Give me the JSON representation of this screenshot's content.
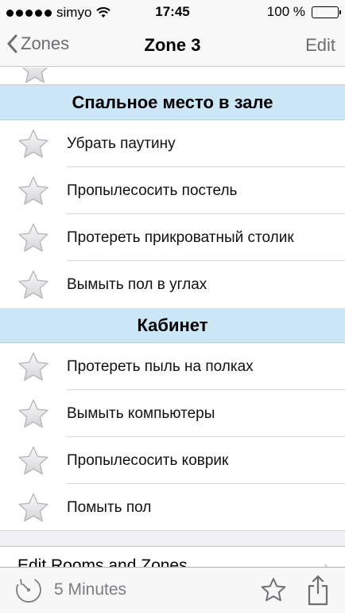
{
  "status_bar": {
    "carrier": "simyo",
    "time": "17:45",
    "battery": "100 %"
  },
  "nav": {
    "back_label": "Zones",
    "title": "Zone 3",
    "edit_label": "Edit"
  },
  "sections": [
    {
      "title": "Спальное место в зале",
      "tasks": [
        "Убрать паутину",
        "Пропылесосить постель",
        "Протереть прикроватный столик",
        "Вымыть пол в углах"
      ]
    },
    {
      "title": "Кабинет",
      "tasks": [
        "Протереть пыль на полках",
        "Вымыть компьютеры",
        "Пропылесосить коврик",
        "Помыть пол"
      ]
    }
  ],
  "footer": {
    "edit_rooms_label": "Edit Rooms and Zones"
  },
  "toolbar": {
    "timer_label": "5 Minutes",
    "timer_icon": "stopwatch-icon",
    "favorite_icon": "star-outline-icon",
    "share_icon": "share-icon"
  },
  "colors": {
    "section_header_bg": "#cbe6f5",
    "nav_tint": "#6d6d72",
    "star_fill": "#e6e6e8"
  }
}
